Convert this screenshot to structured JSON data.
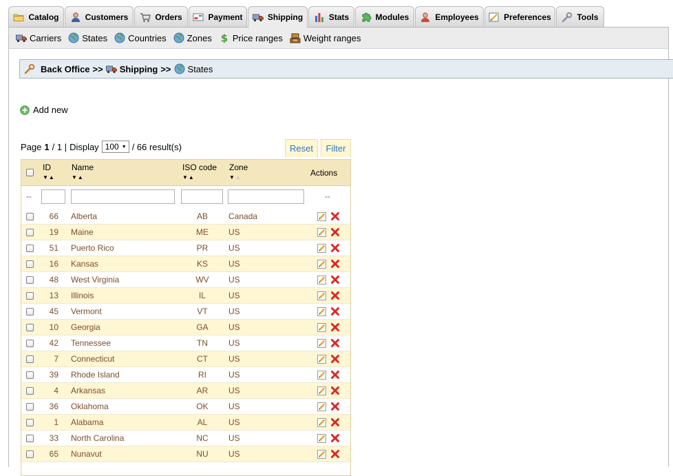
{
  "tabs": [
    {
      "label": "Catalog",
      "icon": "folder-icon"
    },
    {
      "label": "Customers",
      "icon": "customers-icon"
    },
    {
      "label": "Orders",
      "icon": "cart-icon"
    },
    {
      "label": "Payment",
      "icon": "payment-icon"
    },
    {
      "label": "Shipping",
      "icon": "truck-icon",
      "active": true
    },
    {
      "label": "Stats",
      "icon": "chart-icon"
    },
    {
      "label": "Modules",
      "icon": "puzzle-icon"
    },
    {
      "label": "Employees",
      "icon": "employee-icon"
    },
    {
      "label": "Preferences",
      "icon": "preferences-icon"
    },
    {
      "label": "Tools",
      "icon": "wrench-icon"
    }
  ],
  "subnav": [
    {
      "label": "Carriers",
      "icon": "truck-icon"
    },
    {
      "label": "States",
      "icon": "globe-icon"
    },
    {
      "label": "Countries",
      "icon": "globe-icon"
    },
    {
      "label": "Zones",
      "icon": "globe-icon"
    },
    {
      "label": "Price ranges",
      "icon": "dollar-icon"
    },
    {
      "label": "Weight ranges",
      "icon": "scale-icon"
    }
  ],
  "breadcrumb": {
    "root": "Back Office",
    "sep": ">>",
    "section": "Shipping",
    "current": "States"
  },
  "actions": {
    "add_new": "Add new",
    "reset": "Reset",
    "filter": "Filter"
  },
  "pager": {
    "page_label": "Page",
    "page": "1",
    "of": "/ 1 |",
    "display_label": "Display",
    "display_value": "100",
    "results": "/ 66 result(s)"
  },
  "table": {
    "headers": {
      "id": "ID",
      "name": "Name",
      "iso": "ISO code",
      "zone": "Zone",
      "actions": "Actions"
    },
    "filter_placeholder": "--",
    "rows": [
      {
        "id": "66",
        "name": "Alberta",
        "iso": "AB",
        "zone": "Canada"
      },
      {
        "id": "19",
        "name": "Maine",
        "iso": "ME",
        "zone": "US"
      },
      {
        "id": "51",
        "name": "Puerto Rico",
        "iso": "PR",
        "zone": "US"
      },
      {
        "id": "16",
        "name": "Kansas",
        "iso": "KS",
        "zone": "US"
      },
      {
        "id": "48",
        "name": "West Virginia",
        "iso": "WV",
        "zone": "US"
      },
      {
        "id": "13",
        "name": "Illinois",
        "iso": "IL",
        "zone": "US"
      },
      {
        "id": "45",
        "name": "Vermont",
        "iso": "VT",
        "zone": "US"
      },
      {
        "id": "10",
        "name": "Georgia",
        "iso": "GA",
        "zone": "US"
      },
      {
        "id": "42",
        "name": "Tennessee",
        "iso": "TN",
        "zone": "US"
      },
      {
        "id": "7",
        "name": "Connecticut",
        "iso": "CT",
        "zone": "US"
      },
      {
        "id": "39",
        "name": "Rhode Island",
        "iso": "RI",
        "zone": "US"
      },
      {
        "id": "4",
        "name": "Arkansas",
        "iso": "AR",
        "zone": "US"
      },
      {
        "id": "36",
        "name": "Oklahoma",
        "iso": "OK",
        "zone": "US"
      },
      {
        "id": "1",
        "name": "Alabama",
        "iso": "AL",
        "zone": "US"
      },
      {
        "id": "33",
        "name": "North Carolina",
        "iso": "NC",
        "zone": "US"
      },
      {
        "id": "65",
        "name": "Nunavut",
        "iso": "NU",
        "zone": "US"
      }
    ]
  }
}
